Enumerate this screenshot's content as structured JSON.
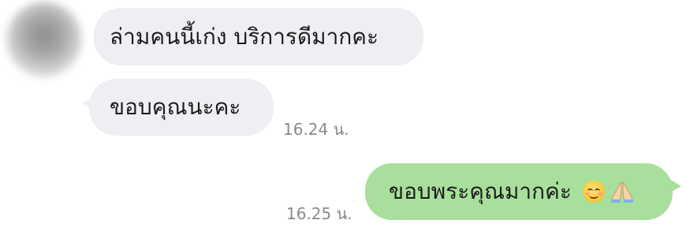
{
  "chat": {
    "incoming": [
      {
        "text": "ล่ามคนนี้เก่ง บริการดีมากคะ"
      },
      {
        "text": "ขอบคุณนะคะ",
        "time": "16.24 น."
      }
    ],
    "outgoing": [
      {
        "text": "ขอบพระคุณมากค่ะ",
        "emoji": [
          "smiling-face-emoji",
          "folded-hands-emoji"
        ],
        "time": "16.25 น."
      }
    ]
  },
  "colors": {
    "incoming_bubble": "#eeeff2",
    "outgoing_bubble": "#a9df9c",
    "timestamp": "#8a8a8a"
  }
}
